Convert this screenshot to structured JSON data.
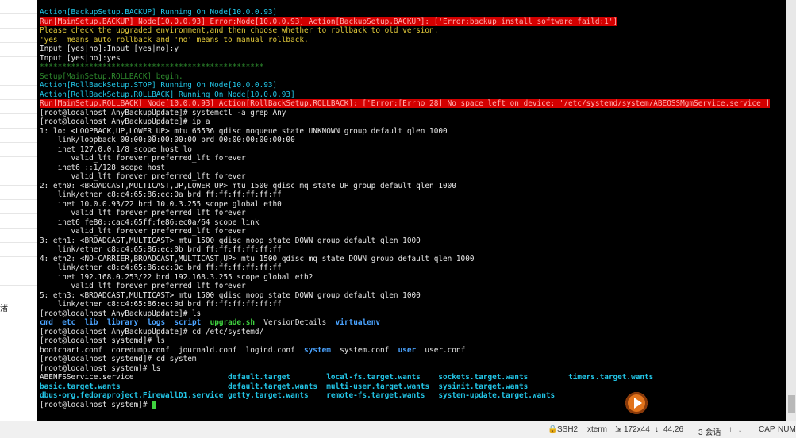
{
  "left_panel": {
    "fragment_text": "渚"
  },
  "terminal": {
    "lines": [
      [
        {
          "t": "Action[BackupSetup.BACKUP] Running On Node[10.0.0.93]",
          "c": "c-cyan"
        }
      ],
      [
        {
          "t": "Run[MainSetup.BACKUP] Node[10.0.0.93] Error:Node[10.0.0.93] Action[BackupSetup.BACKUP]: ['Error:backup install software faild:1']",
          "c": "c-errbar"
        }
      ],
      [
        {
          "t": "Please check the upgraded environment,and then choose whether to rollback to old version.",
          "c": "c-yellow"
        }
      ],
      [
        {
          "t": "'yes' means auto rollback and 'no' means to manual rollback.",
          "c": "c-yellow"
        }
      ],
      [
        {
          "t": "Input [yes|no]:Input [yes|no]:y",
          "c": ""
        }
      ],
      [
        {
          "t": "Input [yes|no]:yes",
          "c": ""
        }
      ],
      [
        {
          "t": "**************************************************",
          "c": "c-darkgreen"
        }
      ],
      [
        {
          "t": "Setup[MainSetup.ROLLBACK] begin.",
          "c": "c-darkgreen"
        }
      ],
      [
        {
          "t": "Action[RollBackSetup.STOP] Running On Node[10.0.0.93]",
          "c": "c-cyan"
        }
      ],
      [
        {
          "t": "Action[RollBackSetup.ROLLBACK] Running On Node[10.0.0.93]",
          "c": "c-cyan"
        }
      ],
      [
        {
          "t": "Run[MainSetup.ROLLBACK] Node[10.0.0.93] Action[RollBackSetup.ROLLBACK]: ['Error:[Errno 28] No space left on device: '/etc/systemd/system/ABEOSSMgmService.service']",
          "c": "c-errbar"
        }
      ],
      [
        {
          "t": "[root@localhost AnyBackupUpdate]# systemctl -a|grep Any",
          "c": ""
        }
      ],
      [
        {
          "t": "[root@localhost AnyBackupUpdate]# ip a",
          "c": ""
        }
      ],
      [
        {
          "t": "1: lo: <LOOPBACK,UP,LOWER_UP> mtu 65536 qdisc noqueue state UNKNOWN group default qlen 1000",
          "c": ""
        }
      ],
      [
        {
          "t": "    link/loopback 00:00:00:00:00:00 brd 00:00:00:00:00:00",
          "c": ""
        }
      ],
      [
        {
          "t": "    inet 127.0.0.1/8 scope host lo",
          "c": ""
        }
      ],
      [
        {
          "t": "       valid_lft forever preferred_lft forever",
          "c": ""
        }
      ],
      [
        {
          "t": "    inet6 ::1/128 scope host",
          "c": ""
        }
      ],
      [
        {
          "t": "       valid_lft forever preferred_lft forever",
          "c": ""
        }
      ],
      [
        {
          "t": "2: eth0: <BROADCAST,MULTICAST,UP,LOWER_UP> mtu 1500 qdisc mq state UP group default qlen 1000",
          "c": ""
        }
      ],
      [
        {
          "t": "    link/ether c8:c4:65:86:ec:0a brd ff:ff:ff:ff:ff:ff",
          "c": ""
        }
      ],
      [
        {
          "t": "    inet 10.0.0.93/22 brd 10.0.3.255 scope global eth0",
          "c": ""
        }
      ],
      [
        {
          "t": "       valid_lft forever preferred_lft forever",
          "c": ""
        }
      ],
      [
        {
          "t": "    inet6 fe80::cac4:65ff:fe86:ec0a/64 scope link",
          "c": ""
        }
      ],
      [
        {
          "t": "       valid_lft forever preferred_lft forever",
          "c": ""
        }
      ],
      [
        {
          "t": "3: eth1: <BROADCAST,MULTICAST> mtu 1500 qdisc noop state DOWN group default qlen 1000",
          "c": ""
        }
      ],
      [
        {
          "t": "    link/ether c8:c4:65:86:ec:0b brd ff:ff:ff:ff:ff:ff",
          "c": ""
        }
      ],
      [
        {
          "t": "4: eth2: <NO-CARRIER,BROADCAST,MULTICAST,UP> mtu 1500 qdisc mq state DOWN group default qlen 1000",
          "c": ""
        }
      ],
      [
        {
          "t": "    link/ether c8:c4:65:86:ec:0c brd ff:ff:ff:ff:ff:ff",
          "c": ""
        }
      ],
      [
        {
          "t": "    inet 192.168.0.253/22 brd 192.168.3.255 scope global eth2",
          "c": ""
        }
      ],
      [
        {
          "t": "       valid_lft forever preferred_lft forever",
          "c": ""
        }
      ],
      [
        {
          "t": "5: eth3: <BROADCAST,MULTICAST> mtu 1500 qdisc noop state DOWN group default qlen 1000",
          "c": ""
        }
      ],
      [
        {
          "t": "    link/ether c8:c4:65:86:ec:0d brd ff:ff:ff:ff:ff:ff",
          "c": ""
        }
      ],
      [
        {
          "t": "[root@localhost AnyBackupUpdate]# ls",
          "c": ""
        }
      ],
      [
        {
          "t": "cmd",
          "c": "c-blue"
        },
        {
          "t": "  ",
          "c": ""
        },
        {
          "t": "etc",
          "c": "c-blue"
        },
        {
          "t": "  ",
          "c": ""
        },
        {
          "t": "lib",
          "c": "c-blue"
        },
        {
          "t": "  ",
          "c": ""
        },
        {
          "t": "library",
          "c": "c-blue"
        },
        {
          "t": "  ",
          "c": ""
        },
        {
          "t": "logs",
          "c": "c-blue"
        },
        {
          "t": "  ",
          "c": ""
        },
        {
          "t": "script",
          "c": "c-blue"
        },
        {
          "t": "  ",
          "c": ""
        },
        {
          "t": "upgrade.sh",
          "c": "c-green-bold"
        },
        {
          "t": "  VersionDetails  ",
          "c": ""
        },
        {
          "t": "virtualenv",
          "c": "c-blue"
        }
      ],
      [
        {
          "t": "[root@localhost AnyBackupUpdate]# cd /etc/systemd/",
          "c": ""
        }
      ],
      [
        {
          "t": "[root@localhost systemd]# ls",
          "c": ""
        }
      ],
      [
        {
          "t": "bootchart.conf  coredump.conf  journald.conf  logind.conf  ",
          "c": ""
        },
        {
          "t": "system",
          "c": "c-blue"
        },
        {
          "t": "  system.conf  ",
          "c": ""
        },
        {
          "t": "user",
          "c": "c-blue"
        },
        {
          "t": "  user.conf",
          "c": ""
        }
      ],
      [
        {
          "t": "[root@localhost systemd]# cd system",
          "c": ""
        }
      ],
      [
        {
          "t": "[root@localhost system]# ls",
          "c": ""
        }
      ],
      [
        {
          "t": "ABENFSService.service                     ",
          "c": ""
        },
        {
          "t": "default.target",
          "c": "c-cyan c-bold"
        },
        {
          "t": "        ",
          "c": ""
        },
        {
          "t": "local-fs.target.wants",
          "c": "c-cyan c-bold"
        },
        {
          "t": "    ",
          "c": ""
        },
        {
          "t": "sockets.target.wants",
          "c": "c-cyan c-bold"
        },
        {
          "t": "         ",
          "c": ""
        },
        {
          "t": "timers.target.wants",
          "c": "c-cyan c-bold"
        }
      ],
      [
        {
          "t": "basic.target.wants",
          "c": "c-cyan c-bold"
        },
        {
          "t": "                        ",
          "c": ""
        },
        {
          "t": "default.target.wants",
          "c": "c-cyan c-bold"
        },
        {
          "t": "  ",
          "c": ""
        },
        {
          "t": "multi-user.target.wants",
          "c": "c-cyan c-bold"
        },
        {
          "t": "  ",
          "c": ""
        },
        {
          "t": "sysinit.target.wants",
          "c": "c-cyan c-bold"
        }
      ],
      [
        {
          "t": "dbus-org.fedoraproject.FirewallD1.service",
          "c": "c-cyan c-bold"
        },
        {
          "t": " ",
          "c": ""
        },
        {
          "t": "getty.target.wants",
          "c": "c-cyan c-bold"
        },
        {
          "t": "    ",
          "c": ""
        },
        {
          "t": "remote-fs.target.wants",
          "c": "c-cyan c-bold"
        },
        {
          "t": "   ",
          "c": ""
        },
        {
          "t": "system-update.target.wants",
          "c": "c-cyan c-bold"
        }
      ],
      [
        {
          "t": "[root@localhost system]# ",
          "c": ""
        },
        {
          "t": "",
          "c": "cursor"
        }
      ]
    ]
  },
  "statusbar": {
    "protocol": "SSH2",
    "terminal_type": "xterm",
    "size": "172x44",
    "cursor_pos": "44,26",
    "sessions": "3 会话",
    "caps": "CAP",
    "num": "NUM",
    "size_icon": "size-icon",
    "cursor_icon": "cursor-icon"
  }
}
